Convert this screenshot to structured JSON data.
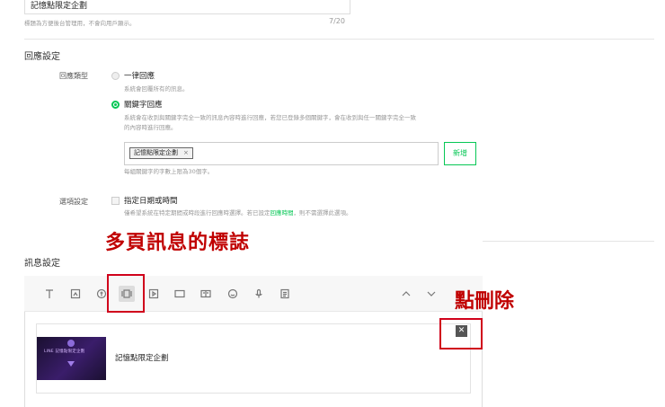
{
  "title_field": {
    "value": "記憶點限定企劃",
    "hint": "標題為方便後台管理用，不會向用戶顯示。",
    "count": "7/20"
  },
  "reply_settings": {
    "heading": "回應設定",
    "reply_type_label": "回應類型",
    "option_all": {
      "label": "一律回應",
      "desc": "系統會回覆所有的訊息。"
    },
    "option_keyword": {
      "label": "關鍵字回應",
      "desc_line1": "系統會在收到與關鍵字完全一致的訊息內容時進行回應，若您已登錄多個關鍵字，會在收到與任一關鍵字完全一致",
      "desc_line2": "的內容時進行回應。"
    },
    "keyword_tag": "記憶點限定企劃",
    "keyword_tag_remove": "×",
    "add_button": "新增",
    "keyword_hint": "每組關鍵字的字數上限為30個字。",
    "options_label": "選項設定",
    "date_option": {
      "label": "指定日期或時間",
      "desc_before": "僅希望系統在特定期間或時段進行回應時選擇。若已設定",
      "desc_link": "回應時間",
      "desc_after": "，則不需選擇此選項。"
    }
  },
  "message_settings": {
    "heading": "訊息設定",
    "toolbar_icons": [
      "text-icon",
      "sticker-icon",
      "coupon-icon",
      "card-message-icon",
      "video-icon",
      "imagemap-icon",
      "rich-video-icon",
      "emoji-icon",
      "voice-icon",
      "survey-icon"
    ],
    "card_title": "記憶點限定企劃",
    "thumb_text": "LINE 記憶點限定企劃"
  },
  "annotations": {
    "multipage_label": "多頁訊息的標誌",
    "delete_label": "點刪除"
  },
  "colors": {
    "accent": "#06c755",
    "annotation": "#c00000"
  }
}
